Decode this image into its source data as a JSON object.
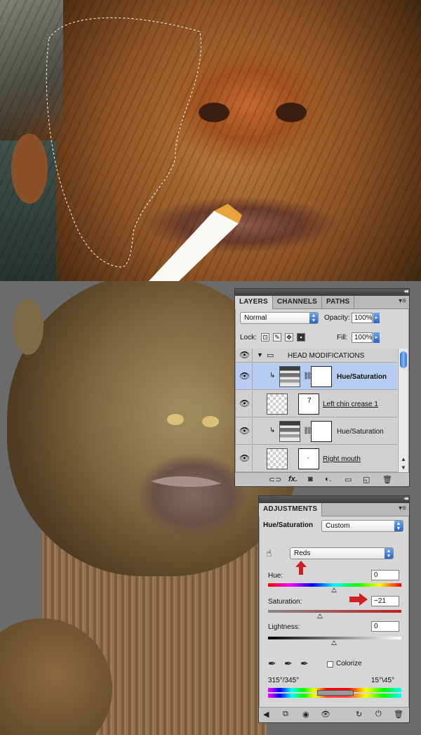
{
  "layers_panel": {
    "tabs": [
      "LAYERS",
      "CHANNELS",
      "PATHS"
    ],
    "active_tab": "LAYERS",
    "blend_mode": "Normal",
    "opacity_label": "Opacity:",
    "opacity_value": "100%",
    "lock_label": "Lock:",
    "fill_label": "Fill:",
    "fill_value": "100%",
    "layers": [
      {
        "name": "HEAD MODIFICATIONS",
        "kind": "group"
      },
      {
        "name": "Hue/Saturation",
        "kind": "adjustment",
        "selected": true
      },
      {
        "name": "Left chin crease 1",
        "kind": "pixel"
      },
      {
        "name": "Hue/Saturation",
        "kind": "adjustment",
        "selected": false
      },
      {
        "name": "Right mouth",
        "kind": "pixel"
      }
    ],
    "bottom_icons": [
      "link-layers-icon",
      "fx-icon",
      "add-mask-icon",
      "adjustment-layer-icon",
      "new-group-icon",
      "new-layer-icon",
      "trash-icon"
    ],
    "fx_label": "fx."
  },
  "adjustments_panel": {
    "tab": "ADJUSTMENTS",
    "adjustment_name": "Hue/Saturation",
    "preset": "Custom",
    "channel": "Reds",
    "hue_label": "Hue:",
    "hue_value": "0",
    "saturation_label": "Saturation:",
    "saturation_value": "−21",
    "lightness_label": "Lightness:",
    "lightness_value": "0",
    "colorize_label": "Colorize",
    "colorize_checked": false,
    "range_left": "315°/345°",
    "range_right": "15°\\45°",
    "highlight_color": "#cc2222",
    "bottom_icons": [
      "back-arrow-icon",
      "clip-icon",
      "view-previous-icon",
      "visibility-icon",
      "reset-icon",
      "power-icon",
      "trash-icon"
    ]
  },
  "colors": {
    "selected_row": "#b6ccf0",
    "scroll_thumb": "#2f6ed6",
    "annotation_arrow": "#cc2222"
  }
}
